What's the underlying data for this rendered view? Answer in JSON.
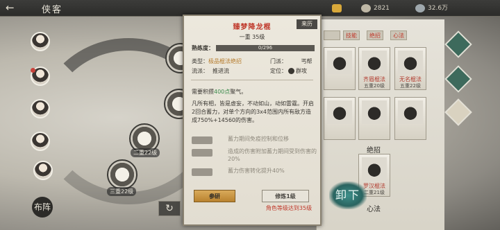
{
  "topbar": {
    "back_icon": "back-arrow-icon",
    "title": "侠客",
    "resources": [
      {
        "icon": "gold-ingot-icon",
        "value": ""
      },
      {
        "icon": "coin-icon",
        "value": "2821"
      },
      {
        "icon": "currency-icon",
        "value": "32.6万"
      }
    ]
  },
  "left": {
    "seal_label": "布阵",
    "reset_icon": "refresh-icon",
    "nodes": [
      {
        "label": "二重22级"
      },
      {
        "label": "三重22级"
      }
    ]
  },
  "right": {
    "tabs": [
      "",
      "技能",
      "绝招",
      "心法"
    ],
    "cards_top": [
      {
        "name": "",
        "lvl": ""
      },
      {
        "name": "",
        "lvl": ""
      },
      {
        "name": "齐眉棍法",
        "lvl": "五重20级"
      },
      {
        "name": "无名棍法",
        "lvl": "五重22级"
      }
    ],
    "cards_mid": [
      {
        "name": "",
        "lvl": ""
      },
      {
        "name": "",
        "lvl": ""
      },
      {
        "name": "",
        "lvl": ""
      }
    ],
    "section_ultimate": "绝招",
    "card_ultimate": {
      "name": "罗汉棍法",
      "lvl": "二重21级"
    },
    "section_mental": "心法",
    "unequip_label": "卸下"
  },
  "panel": {
    "title": "臻梦降龙棍",
    "source_button": "来历",
    "level": "一重 35级",
    "proficiency_label": "熟练度：",
    "proficiency_text": "0/296",
    "proficiency_fraction": 0,
    "type_label": "类型：",
    "type_value": "极品棍法绝招",
    "faction_label": "门派：",
    "faction_value": "丐帮",
    "school_label": "流派：",
    "school_value": "推进流",
    "position_label": "定位：",
    "position_value": "群攻",
    "requirement_prefix": "需要积攒",
    "requirement_value": "400点",
    "requirement_suffix": "聚气。",
    "description": "凡所有相，皆是虚妄，不动如山，动如雷霆。开启2回合蓄力，对单个方向的3x4范围内所有敌方造成750%+14560的伤害。",
    "attributes": [
      {
        "text": "蓄力期间免疫控制和位移"
      },
      {
        "text": "造成的伤害附加蓄力期间受到伤害的20%"
      },
      {
        "text": "蓄力伤害转化提升40%"
      }
    ],
    "study_button": "参研",
    "cultivate_button": "修炼1级",
    "condition_text": "角色等级达到35级"
  },
  "colors": {
    "title_red": "#c0392b",
    "highlight_green": "#3a8a4a",
    "study_gold": "#c9953f"
  }
}
